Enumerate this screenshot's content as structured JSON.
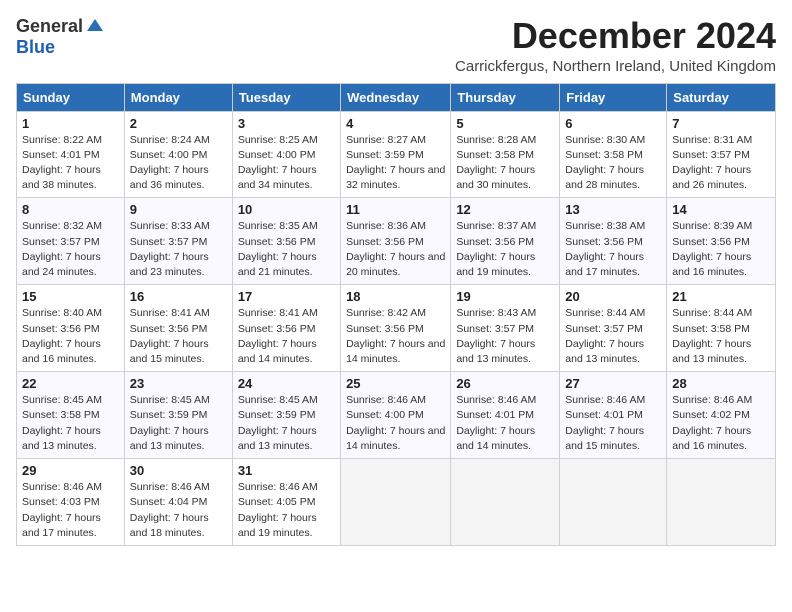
{
  "header": {
    "logo_general": "General",
    "logo_blue": "Blue",
    "title": "December 2024",
    "subtitle": "Carrickfergus, Northern Ireland, United Kingdom"
  },
  "days_of_week": [
    "Sunday",
    "Monday",
    "Tuesday",
    "Wednesday",
    "Thursday",
    "Friday",
    "Saturday"
  ],
  "weeks": [
    [
      {
        "day": "1",
        "sunrise": "8:22 AM",
        "sunset": "4:01 PM",
        "daylight": "7 hours and 38 minutes."
      },
      {
        "day": "2",
        "sunrise": "8:24 AM",
        "sunset": "4:00 PM",
        "daylight": "7 hours and 36 minutes."
      },
      {
        "day": "3",
        "sunrise": "8:25 AM",
        "sunset": "4:00 PM",
        "daylight": "7 hours and 34 minutes."
      },
      {
        "day": "4",
        "sunrise": "8:27 AM",
        "sunset": "3:59 PM",
        "daylight": "7 hours and 32 minutes."
      },
      {
        "day": "5",
        "sunrise": "8:28 AM",
        "sunset": "3:58 PM",
        "daylight": "7 hours and 30 minutes."
      },
      {
        "day": "6",
        "sunrise": "8:30 AM",
        "sunset": "3:58 PM",
        "daylight": "7 hours and 28 minutes."
      },
      {
        "day": "7",
        "sunrise": "8:31 AM",
        "sunset": "3:57 PM",
        "daylight": "7 hours and 26 minutes."
      }
    ],
    [
      {
        "day": "8",
        "sunrise": "8:32 AM",
        "sunset": "3:57 PM",
        "daylight": "7 hours and 24 minutes."
      },
      {
        "day": "9",
        "sunrise": "8:33 AM",
        "sunset": "3:57 PM",
        "daylight": "7 hours and 23 minutes."
      },
      {
        "day": "10",
        "sunrise": "8:35 AM",
        "sunset": "3:56 PM",
        "daylight": "7 hours and 21 minutes."
      },
      {
        "day": "11",
        "sunrise": "8:36 AM",
        "sunset": "3:56 PM",
        "daylight": "7 hours and 20 minutes."
      },
      {
        "day": "12",
        "sunrise": "8:37 AM",
        "sunset": "3:56 PM",
        "daylight": "7 hours and 19 minutes."
      },
      {
        "day": "13",
        "sunrise": "8:38 AM",
        "sunset": "3:56 PM",
        "daylight": "7 hours and 17 minutes."
      },
      {
        "day": "14",
        "sunrise": "8:39 AM",
        "sunset": "3:56 PM",
        "daylight": "7 hours and 16 minutes."
      }
    ],
    [
      {
        "day": "15",
        "sunrise": "8:40 AM",
        "sunset": "3:56 PM",
        "daylight": "7 hours and 16 minutes."
      },
      {
        "day": "16",
        "sunrise": "8:41 AM",
        "sunset": "3:56 PM",
        "daylight": "7 hours and 15 minutes."
      },
      {
        "day": "17",
        "sunrise": "8:41 AM",
        "sunset": "3:56 PM",
        "daylight": "7 hours and 14 minutes."
      },
      {
        "day": "18",
        "sunrise": "8:42 AM",
        "sunset": "3:56 PM",
        "daylight": "7 hours and 14 minutes."
      },
      {
        "day": "19",
        "sunrise": "8:43 AM",
        "sunset": "3:57 PM",
        "daylight": "7 hours and 13 minutes."
      },
      {
        "day": "20",
        "sunrise": "8:44 AM",
        "sunset": "3:57 PM",
        "daylight": "7 hours and 13 minutes."
      },
      {
        "day": "21",
        "sunrise": "8:44 AM",
        "sunset": "3:58 PM",
        "daylight": "7 hours and 13 minutes."
      }
    ],
    [
      {
        "day": "22",
        "sunrise": "8:45 AM",
        "sunset": "3:58 PM",
        "daylight": "7 hours and 13 minutes."
      },
      {
        "day": "23",
        "sunrise": "8:45 AM",
        "sunset": "3:59 PM",
        "daylight": "7 hours and 13 minutes."
      },
      {
        "day": "24",
        "sunrise": "8:45 AM",
        "sunset": "3:59 PM",
        "daylight": "7 hours and 13 minutes."
      },
      {
        "day": "25",
        "sunrise": "8:46 AM",
        "sunset": "4:00 PM",
        "daylight": "7 hours and 14 minutes."
      },
      {
        "day": "26",
        "sunrise": "8:46 AM",
        "sunset": "4:01 PM",
        "daylight": "7 hours and 14 minutes."
      },
      {
        "day": "27",
        "sunrise": "8:46 AM",
        "sunset": "4:01 PM",
        "daylight": "7 hours and 15 minutes."
      },
      {
        "day": "28",
        "sunrise": "8:46 AM",
        "sunset": "4:02 PM",
        "daylight": "7 hours and 16 minutes."
      }
    ],
    [
      {
        "day": "29",
        "sunrise": "8:46 AM",
        "sunset": "4:03 PM",
        "daylight": "7 hours and 17 minutes."
      },
      {
        "day": "30",
        "sunrise": "8:46 AM",
        "sunset": "4:04 PM",
        "daylight": "7 hours and 18 minutes."
      },
      {
        "day": "31",
        "sunrise": "8:46 AM",
        "sunset": "4:05 PM",
        "daylight": "7 hours and 19 minutes."
      },
      null,
      null,
      null,
      null
    ]
  ],
  "labels": {
    "sunrise": "Sunrise:",
    "sunset": "Sunset:",
    "daylight": "Daylight:"
  }
}
